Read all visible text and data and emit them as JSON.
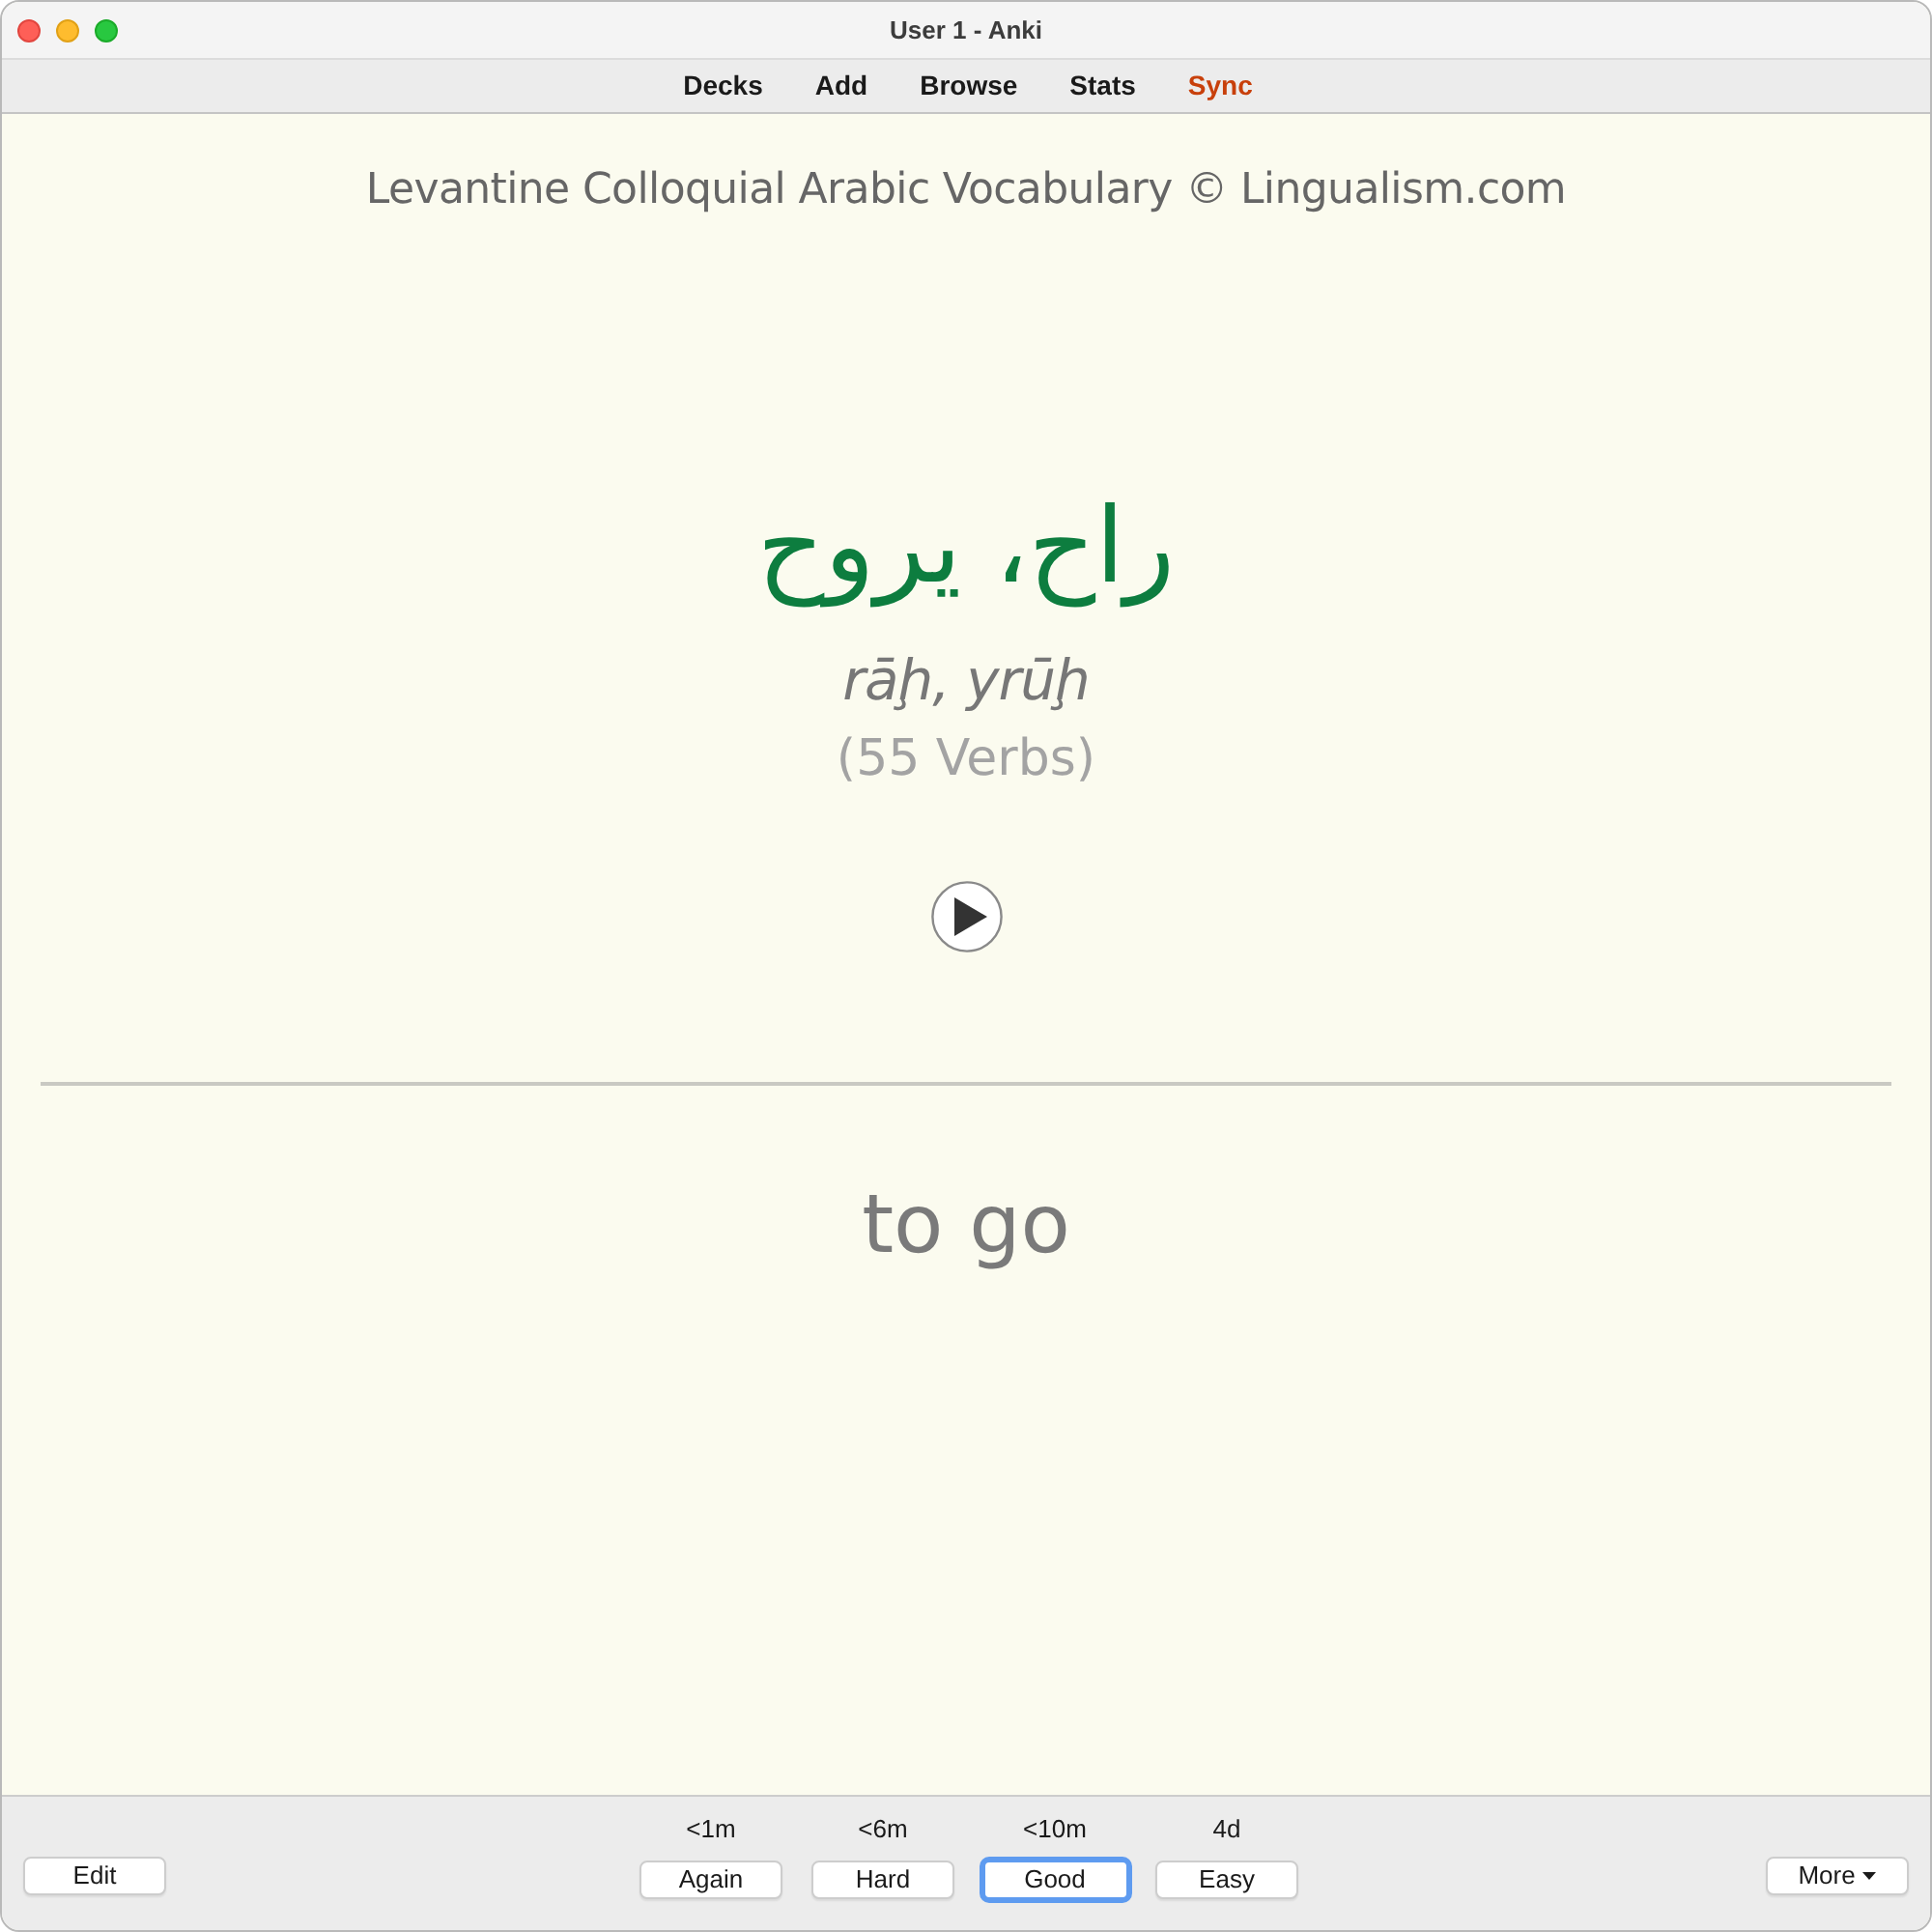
{
  "window": {
    "title": "User 1 - Anki"
  },
  "toolbar": [
    {
      "label": "Decks",
      "highlighted": false
    },
    {
      "label": "Add",
      "highlighted": false
    },
    {
      "label": "Browse",
      "highlighted": false
    },
    {
      "label": "Stats",
      "highlighted": false
    },
    {
      "label": "Sync",
      "highlighted": true
    }
  ],
  "card": {
    "deck_header": "Levantine Colloquial Arabic Vocabulary © Lingualism.com",
    "word": "راح، يروح",
    "transliteration": "rāḩ, yrūḩ",
    "category": "(55 Verbs)",
    "answer": "to go"
  },
  "bottom_bar": {
    "edit_button": "Edit",
    "answers": [
      {
        "interval": "<1m",
        "label": "Again",
        "focused": false
      },
      {
        "interval": "<6m",
        "label": "Hard",
        "focused": false
      },
      {
        "interval": "<10m",
        "label": "Good",
        "focused": true
      },
      {
        "interval": "4d",
        "label": "Easy",
        "focused": false
      }
    ],
    "more_button": "More"
  }
}
